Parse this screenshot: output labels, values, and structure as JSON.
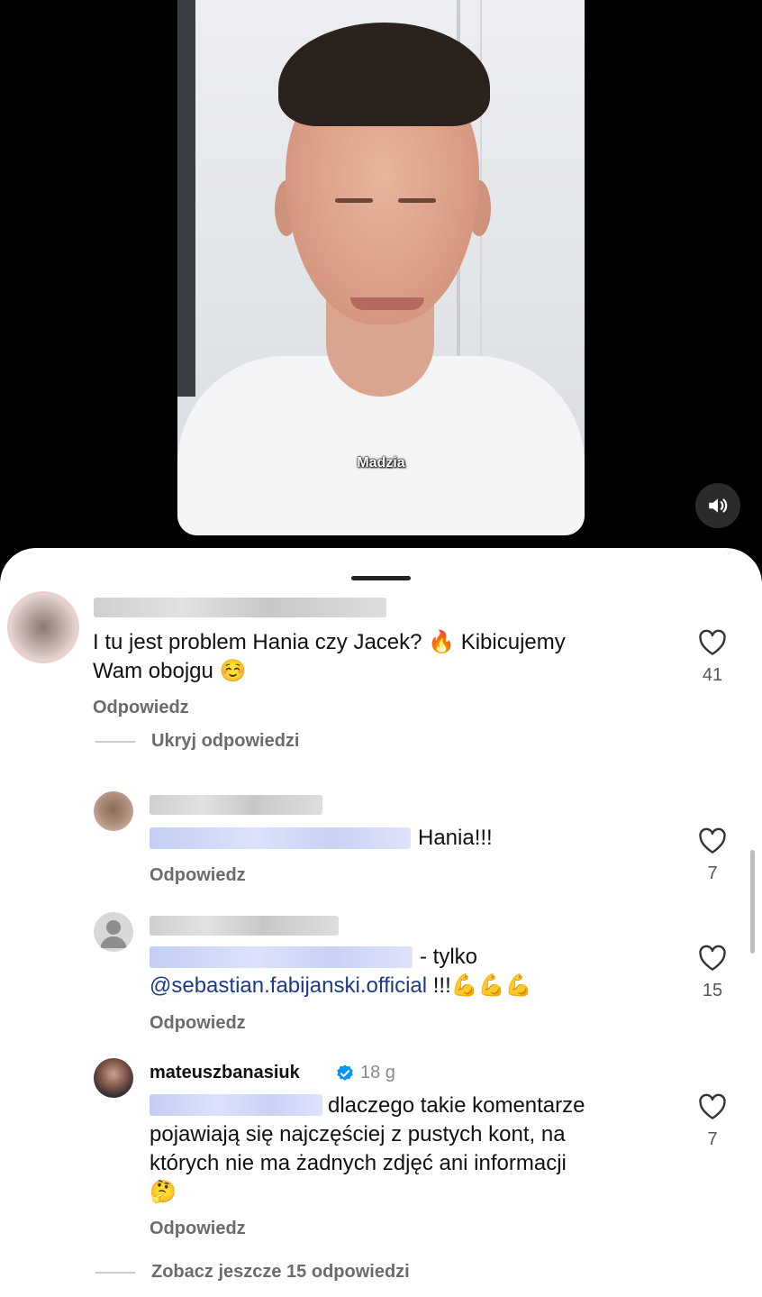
{
  "video": {
    "caption": "Madzia",
    "mute_icon": "speaker-icon"
  },
  "comments": [
    {
      "text": "I tu jest problem Hania czy Jacek? 🔥 Kibicujemy Wam obojgu ☺️",
      "text_line1": "I tu jest problem Hania czy Jacek? 🔥 Kibicujemy",
      "text_line2": "Wam obojgu ☺️",
      "reply_label": "Odpowiedz",
      "likes": "41"
    }
  ],
  "thread": {
    "hide_label": "Ukryj odpowiedzi",
    "more_label": "Zobacz jeszcze 15 odpowiedzi"
  },
  "replies": [
    {
      "text": "Hania!!!",
      "reply_label": "Odpowiedz",
      "likes": "7"
    },
    {
      "text_before": "- tylko",
      "mention": "@sebastian.fabijanski.official",
      "text_after": "!!!💪💪💪",
      "reply_label": "Odpowiedz",
      "likes": "15"
    },
    {
      "username": "mateuszbanasiuk",
      "timestamp": "18 g",
      "line1": "dlaczego takie komentarze",
      "line2": "pojawiają się najczęściej z pustych kont, na",
      "line3": "których nie ma żadnych zdjęć ani informacji",
      "line4": "🤔",
      "reply_label": "Odpowiedz",
      "likes": "7"
    }
  ],
  "icons": {
    "like": "heart-outline-icon",
    "verified": "verified-badge-icon",
    "verified_color": "#0095f6"
  }
}
